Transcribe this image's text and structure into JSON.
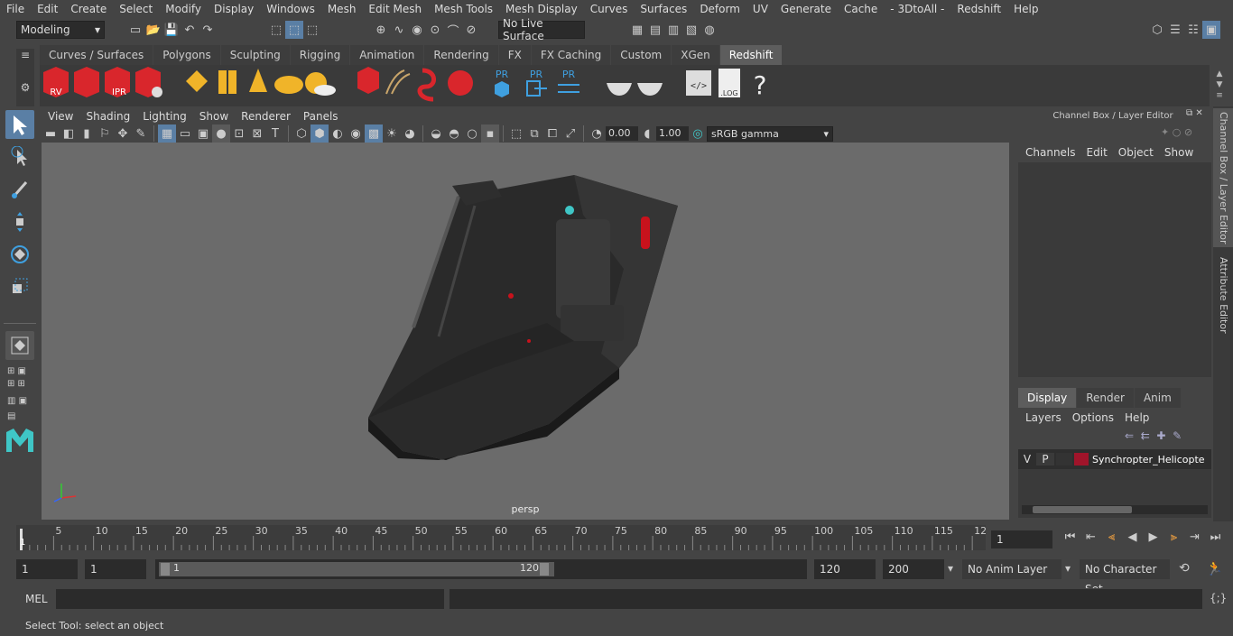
{
  "menubar": [
    "File",
    "Edit",
    "Create",
    "Select",
    "Modify",
    "Display",
    "Windows",
    "Mesh",
    "Edit Mesh",
    "Mesh Tools",
    "Mesh Display",
    "Curves",
    "Surfaces",
    "Deform",
    "UV",
    "Generate",
    "Cache",
    "- 3DtoAll -",
    "Redshift",
    "Help"
  ],
  "status": {
    "mode": "Modeling",
    "live_surface": "No Live Surface"
  },
  "shelf_tabs": [
    "Curves / Surfaces",
    "Polygons",
    "Sculpting",
    "Rigging",
    "Animation",
    "Rendering",
    "FX",
    "FX Caching",
    "Custom",
    "XGen",
    "Redshift"
  ],
  "shelf_active": "Redshift",
  "shelf_labels": {
    "rv": "RV",
    "ipr": "IPR",
    "pr1": "PR",
    "pr2": "PR",
    "pr3": "PR",
    "log": ".LOG",
    "help": "?"
  },
  "viewport": {
    "menus": [
      "View",
      "Shading",
      "Lighting",
      "Show",
      "Renderer",
      "Panels"
    ],
    "exposure": "0.00",
    "gamma": "1.00",
    "colorspace": "sRGB gamma",
    "camera": "persp"
  },
  "channel_box": {
    "title": "Channel Box / Layer Editor",
    "menus": [
      "Channels",
      "Edit",
      "Object",
      "Show"
    ],
    "layer_tabs": [
      "Display",
      "Render",
      "Anim"
    ],
    "layer_active": "Display",
    "layer_menus": [
      "Layers",
      "Options",
      "Help"
    ],
    "layer": {
      "v": "V",
      "p": "P",
      "name": "Synchropter_Helicopte",
      "color": "#a0142a"
    }
  },
  "side_tabs": [
    "Channel Box / Layer Editor",
    "Attribute Editor"
  ],
  "timeline": {
    "ticks": [
      "5",
      "10",
      "15",
      "20",
      "25",
      "30",
      "35",
      "40",
      "45",
      "50",
      "55",
      "60",
      "65",
      "70",
      "75",
      "80",
      "85",
      "90",
      "95",
      "100",
      "105",
      "110",
      "115",
      "12"
    ],
    "current_marker": "1",
    "current_frame": "1"
  },
  "range": {
    "start": "1",
    "playback_start": "1",
    "slider_start": "1",
    "slider_end": "120",
    "playback_end": "120",
    "end": "200",
    "anim_layer": "No Anim Layer",
    "char_set": "No Character Set"
  },
  "cmd": {
    "label": "MEL"
  },
  "help_text": "Select Tool: select an object",
  "colors": {
    "accent": "#5a7fa5",
    "redshift_red": "#d9262c",
    "yellow": "#f0b429",
    "cyan": "#3fc6c6"
  }
}
